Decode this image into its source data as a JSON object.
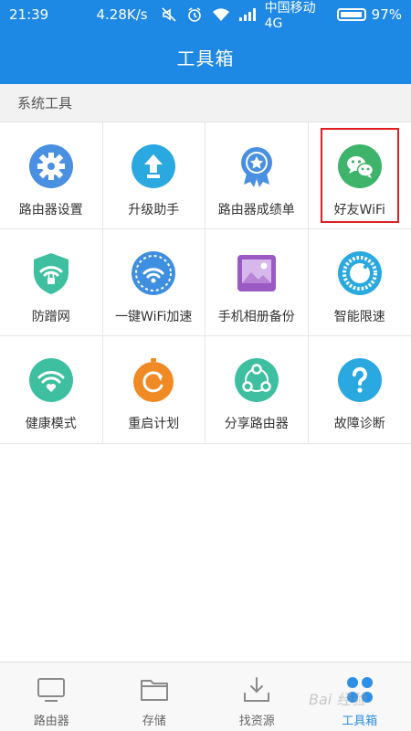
{
  "status_bar": {
    "time": "21:39",
    "speed": "4.28K/s",
    "carrier": "中国移动 4G",
    "battery": "97%",
    "battery_level": 0.97,
    "icons": [
      "mute-icon",
      "alarm-icon",
      "wifi-icon",
      "signal-icon",
      "battery-icon"
    ]
  },
  "header": {
    "title": "工具箱"
  },
  "section": {
    "title": "系统工具"
  },
  "tools": [
    {
      "label": "路由器设置",
      "icon": "gear-icon",
      "color": "#4a90e2"
    },
    {
      "label": "升级助手",
      "icon": "upload-arrow-icon",
      "color": "#2aa8e0"
    },
    {
      "label": "路由器成绩单",
      "icon": "award-ribbon-icon",
      "color": "#4a90e2"
    },
    {
      "label": "好友WiFi",
      "icon": "wechat-icon",
      "color": "#3eb36a",
      "highlighted": true
    },
    {
      "label": "防蹭网",
      "icon": "shield-wifi-icon",
      "color": "#3dbfa0"
    },
    {
      "label": "一键WiFi加速",
      "icon": "wifi-speedometer-icon",
      "color": "#3f8fe0"
    },
    {
      "label": "手机相册备份",
      "icon": "photo-album-icon",
      "color": "#9b59c4"
    },
    {
      "label": "智能限速",
      "icon": "dial-gauge-icon",
      "color": "#2aa8e0"
    },
    {
      "label": "健康模式",
      "icon": "heart-wifi-icon",
      "color": "#3dbfa0"
    },
    {
      "label": "重启计划",
      "icon": "restart-timer-icon",
      "color": "#f08a24"
    },
    {
      "label": "分享路由器",
      "icon": "share-nodes-icon",
      "color": "#3dbfa0"
    },
    {
      "label": "故障诊断",
      "icon": "question-icon",
      "color": "#2aa8e0"
    }
  ],
  "bottom_nav": [
    {
      "label": "路由器",
      "icon": "monitor-icon",
      "active": false
    },
    {
      "label": "存储",
      "icon": "folder-icon",
      "active": false
    },
    {
      "label": "找资源",
      "icon": "download-tray-icon",
      "active": false
    },
    {
      "label": "工具箱",
      "icon": "toolbox-dots-icon",
      "active": true
    }
  ],
  "colors": {
    "primary": "#1e88e5",
    "highlight_border": "#e02020",
    "nav_active": "#2e8fe6",
    "nav_inactive": "#8a8a8a"
  },
  "watermark": "Bai 经验"
}
